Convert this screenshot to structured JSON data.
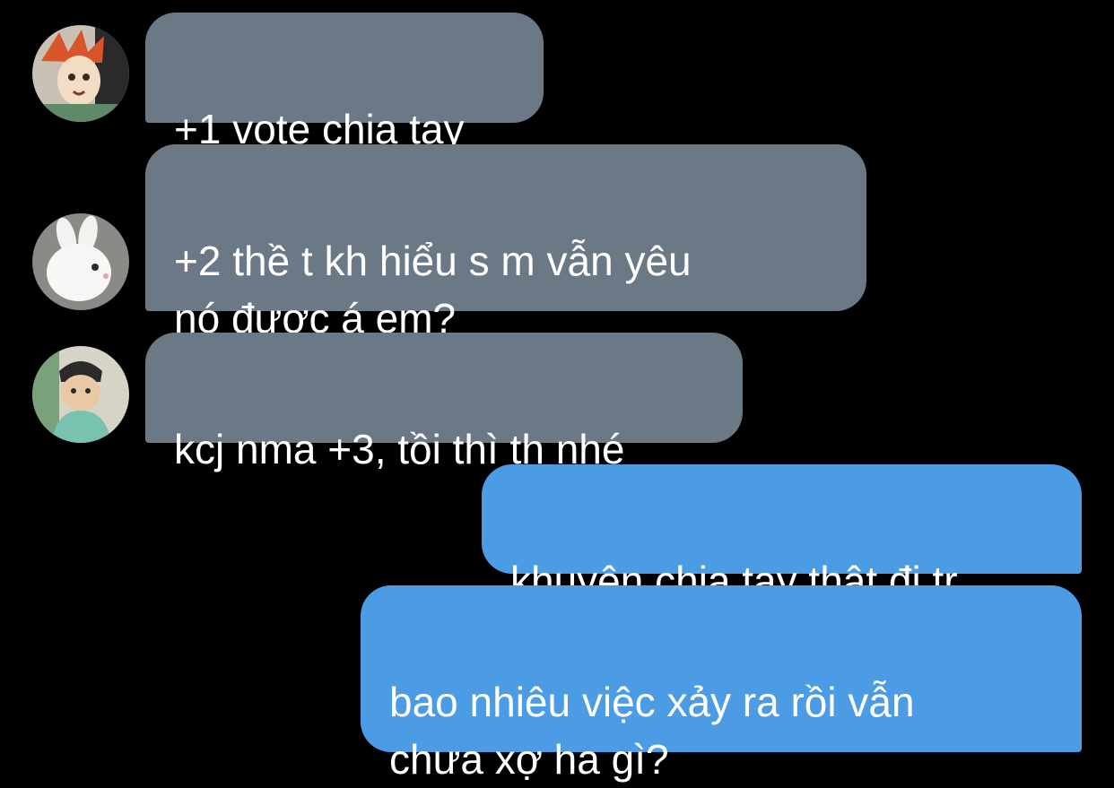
{
  "conversation": {
    "messages": [
      {
        "direction": "incoming",
        "avatar": "anime-boy-avatar",
        "text": "+1 vote chia tay"
      },
      {
        "direction": "incoming",
        "avatar": "white-rabbit-avatar",
        "text": "+2 thề t kh hiểu s m vẫn yêu\nnó được á em?"
      },
      {
        "direction": "incoming",
        "avatar": "manga-man-avatar",
        "text": "kcj nma +3, tồi thì th nhé"
      },
      {
        "direction": "outgoing",
        "text": "khuyên chia tay thật đi tr"
      },
      {
        "direction": "outgoing",
        "text": "bao nhiêu việc xảy ra rồi vẫn\nchưa xợ ha gì?"
      }
    ]
  },
  "colors": {
    "background": "#000000",
    "incoming_bubble": "#6b7886",
    "outgoing_bubble": "#4b9be5",
    "text": "#ffffff"
  }
}
